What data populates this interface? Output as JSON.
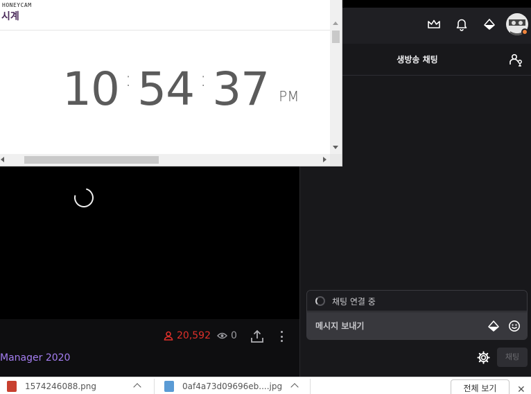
{
  "clock_window": {
    "watermark": "HONEYCAM",
    "title": "시계",
    "time": {
      "hours": "10",
      "minutes": "54",
      "seconds": "37",
      "sep": ":",
      "ampm": "PM"
    }
  },
  "topbar": {
    "icons": [
      "crown-icon",
      "bell-icon",
      "diamond-icon"
    ]
  },
  "chat": {
    "title": "생방송 채팅",
    "status": "채팅 연결 중",
    "input_placeholder": "메시지 보내기",
    "send_label": "채팅"
  },
  "stream": {
    "viewers": "20,592",
    "views": "0",
    "category": "Manager 2020"
  },
  "downloads": {
    "items": [
      {
        "name": "1574246088.png"
      },
      {
        "name": "0af4a73d09696eb....jpg"
      }
    ],
    "show_all_label": "전체 보기",
    "close_label": "✕"
  },
  "colors": {
    "accent_purple": "#a57ef2",
    "viewer_red": "#e0302a",
    "chat_bg": "#18181b",
    "topbar_bg": "#1f1f23"
  }
}
